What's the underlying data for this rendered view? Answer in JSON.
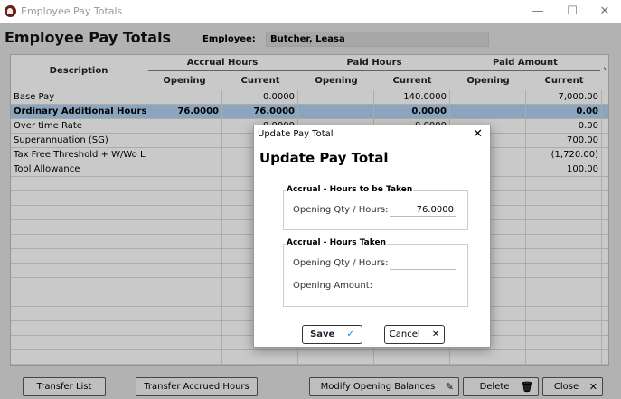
{
  "window": {
    "title": "Employee Pay Totals",
    "minimize": "—",
    "maximize": "☐",
    "close": "✕"
  },
  "header": {
    "title": "Employee Pay Totals",
    "employee_label": "Employee:",
    "employee_name": "Butcher, Leasa"
  },
  "table": {
    "col_description": "Description",
    "group_accrual": "Accrual Hours",
    "group_paid_hours": "Paid Hours",
    "group_paid_amount": "Paid Amount",
    "sub_opening": "Opening",
    "sub_current": "Current",
    "rows": [
      {
        "desc": "Base Pay",
        "acc_open": "",
        "acc_cur": "0.0000",
        "ph_open": "",
        "ph_cur": "140.0000",
        "pa_open": "",
        "pa_cur": "7,000.00"
      },
      {
        "desc": "Ordinary Additional Hours",
        "acc_open": "76.0000",
        "acc_cur": "76.0000",
        "ph_open": "",
        "ph_cur": "0.0000",
        "pa_open": "",
        "pa_cur": "0.00"
      },
      {
        "desc": "Over time Rate",
        "acc_open": "",
        "acc_cur": "0.0000",
        "ph_open": "",
        "ph_cur": "0.0000",
        "pa_open": "",
        "pa_cur": "0.00"
      },
      {
        "desc": "Superannuation (SG)",
        "acc_open": "",
        "acc_cur": "",
        "ph_open": "",
        "ph_cur": "",
        "pa_open": "",
        "pa_cur": "700.00"
      },
      {
        "desc": "Tax Free Threshold  + W/Wo Le",
        "acc_open": "",
        "acc_cur": "",
        "ph_open": "",
        "ph_cur": "",
        "pa_open": "",
        "pa_cur": "(1,720.00)"
      },
      {
        "desc": "Tool Allowance",
        "acc_open": "",
        "acc_cur": "",
        "ph_open": "",
        "ph_cur": "",
        "pa_open": "",
        "pa_cur": "100.00"
      }
    ]
  },
  "buttons": {
    "transfer_list": "Transfer List",
    "transfer_accrued": "Transfer Accrued Hours",
    "modify_opening": "Modify Opening Balances",
    "delete": "Delete",
    "close": "Close"
  },
  "dialog": {
    "title": "Update Pay Total",
    "heading": "Update Pay Total",
    "group1_title": "Accrual - Hours to be Taken",
    "group1_field_label": "Opening Qty / Hours:",
    "group1_field_value": "76.0000",
    "group2_title": "Accrual - Hours Taken",
    "group2_qty_label": "Opening Qty / Hours:",
    "group2_qty_value": "",
    "group2_amount_label": "Opening Amount:",
    "group2_amount_value": "",
    "save_label": "Save",
    "cancel_label": "Cancel"
  },
  "icons": {
    "pencil": "pencil-icon",
    "trash": "trash-icon",
    "x": "x-icon",
    "check": "check-icon"
  },
  "colors": {
    "selected_row": "#a9c7e6",
    "check_accent": "#1e88e5"
  }
}
